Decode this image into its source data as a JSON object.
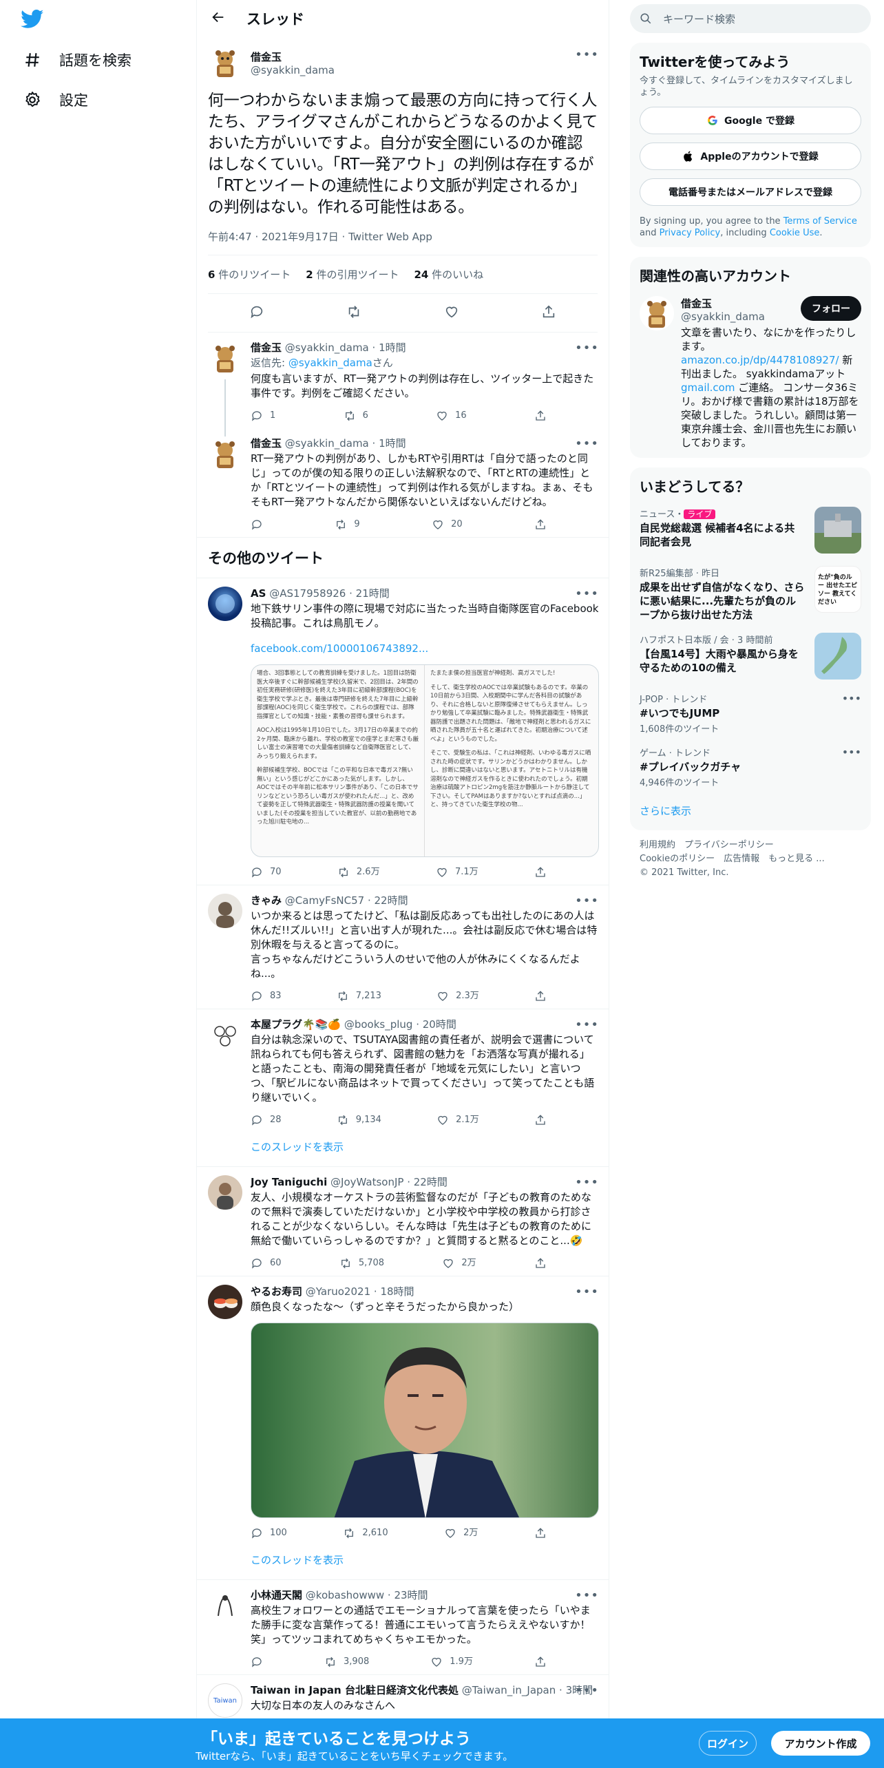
{
  "nav": {
    "explore": "話題を検索",
    "settings": "設定"
  },
  "header": {
    "title": "スレッド"
  },
  "focal": {
    "name": "借金玉",
    "handle": "@syakkin_dama",
    "text": "何一つわからないまま煽って最悪の方向に持って行く人たち、アライグマさんがこれからどうなるのかよく見ておいた方がいいですよ。自分が安全圏にいるのか確認はしなくていい。「RT一発アウト」の判例は存在するが「RTとツイートの連続性により文脈が判定されるか」の判例はない。作れる可能性はある。",
    "time": "午前4:47 · 2021年9月17日 · Twitter Web App",
    "retweets_n": "6",
    "retweets_label": "件のリツイート",
    "quotes_n": "2",
    "quotes_label": "件の引用ツイート",
    "likes_n": "24",
    "likes_label": "件のいいね"
  },
  "replies": [
    {
      "name": "借金玉",
      "handle": "@syakkin_dama",
      "time": "1時間",
      "reply_to_prefix": "返信先:",
      "reply_to_handle": "@syakkin_dama",
      "reply_to_suffix": "さん",
      "text": "何度も言いますが、RT一発アウトの判例は存在し、ツイッター上で起きた事件です。判例をご確認ください。",
      "reply": "1",
      "rt": "6",
      "like": "16"
    },
    {
      "name": "借金玉",
      "handle": "@syakkin_dama",
      "time": "1時間",
      "text": "RT一発アウトの判例があり、しかもRTや引用RTは「自分で語ったのと同じ」ってのが僕の知る限りの正しい法解釈なので、「RTとRTの連続性」とか「RTとツイートの連続性」って判例は作れる気がしますね。まぁ、そもそもRT一発アウトなんだから関係ないといえばないんだけどね。",
      "reply": "",
      "rt": "9",
      "like": "20"
    }
  ],
  "other_tweets_title": "その他のツイート",
  "tweets": [
    {
      "name": "AS",
      "handle": "@AS17958926",
      "time": "21時間",
      "text": "地下鉄サリン事件の際に現場で対応に当たった当時自衛隊医官のFacebook投稿記事。これは鳥肌モノ。",
      "link": "facebook.com/10000106743892...",
      "img_left": [
        "場合、3回事態としての教育訓練を受けました。1回目は防衛医大卒後すぐに幹部候補生学校(久留米で、2回目は、2年間の初任実務研修(研修医)を終えた3年目に初級幹部課程(BOC)を衛生学校で学ぶとき。最後は専門研修を終えた7年目に上級幹部課程(AOC)を同じく衛生学校で。これらの課程では、部隊指揮官としての知識・技能・素養の習得も課せられます。",
        "AOC入校は1995年1月10日でした。3月17日の卒業までの約2ヶ月間、臨床から離れ、学校の教室での座学とまだ寒さも厳しい富士の演習場での大量傷者訓練など自衛隊医官として、みっちり鍛えられます。",
        "幹部候補生学校、BOCでは「この平和な日本で毒ガス?無い無い」という感じがどこかにあった気がします。しかし、AOCではその半年前に松本サリン事件があり、「この日本でサリンなどという恐ろしい毒ガスが使われたんだ...」と、改めて姿勢を正して特殊武器衛生・特殊武器防護の授業を聞いていました(その授業を担当していた教官が、以前の勤務地であった旭川駐屯地の..."
      ],
      "img_right": [
        "たまたま僕の担当医官が神経剤、高ガスでした!",
        "そして、衛生学校のAOCでは卒業試験もあるのです。卒業の10日前から3日間、入校期間中に学んだ各科目の試験があり、それに合格しないと原隊復帰させてもらえません。しっかり勉強して卒業試験に臨みました。特殊武器衛生・特殊武器防護で出題された問題は、「敵地で神経剤と思われるガスに晒された隊員が五十名と運ばれてきた。初期治療について述べよ」というものでした。",
        "そこで、受験生の私は、「これは神経剤、いわゆる毒ガスに晒された時の症状です。サリンかどうかはわかりません。しかし、診断に間違いはないと思います。アセトニトリルは有機溶剤なので神経ガスを作るときに使われたのでしょう。初期治療は硫酸アトロピン2mgを筋注か静脈ルートから静注して下さい。そしてPAMはありますか?ないとすれば点滴の...」と、持ってきていた衛生学校の物..."
      ],
      "reply": "70",
      "rt": "2.6万",
      "like": "7.1万"
    },
    {
      "name": "きゃみ",
      "handle": "@CamyFsNC57",
      "time": "22時間",
      "text": "いつか来るとは思ってたけど、「私は副反応あっても出社したのにあの人は休んだ!!ズルい!!」と言い出す人が現れた...。会社は副反応で休む場合は特別休暇を与えると言ってるのに。\n言っちゃなんだけどこういう人のせいで他の人が休みにくくなるんだよね...。",
      "reply": "83",
      "rt": "7,213",
      "like": "2.3万"
    },
    {
      "name": "本屋プラグ🌴📚🍊",
      "handle": "@books_plug",
      "time": "20時間",
      "text": "自分は執念深いので、TSUTAYA図書館の責任者が、説明会で選書について訊ねられても何も答えられず、図書館の魅力を「お洒落な写真が撮れる」と語ったことも、南海の開発責任者が「地域を元気にしたい」と言いつつ、「駅ビルにない商品はネットで買ってください」って笑ってたことも語り継いでいく。",
      "reply": "28",
      "rt": "9,134",
      "like": "2.1万",
      "show_thread": "このスレッドを表示"
    },
    {
      "name": "Joy Taniguchi",
      "handle": "@JoyWatsonJP",
      "time": "22時間",
      "text": "友人、小規模なオーケストラの芸術監督なのだが「子どもの教育のためなので無料で演奏していただけないか」と小学校や中学校の教員から打診されることが少なくないらしい。そんな時は「先生は子どもの教育のために無給で働いていらっしゃるのですか？」と質問すると黙るとのこと...🤣",
      "reply": "60",
      "rt": "5,708",
      "like": "2万"
    },
    {
      "name": "やるお寿司",
      "handle": "@Yaruo2021",
      "time": "18時間",
      "text": "顔色良くなったな〜（ずっと辛そうだったから良かった）",
      "reply": "100",
      "rt": "2,610",
      "like": "2万",
      "show_thread": "このスレッドを表示"
    },
    {
      "name": "小林通天閣",
      "handle": "@kobashowww",
      "time": "23時間",
      "text": "高校生フォロワーとの通話でエモーショナルって言葉を使ったら「いやまた勝手に変な言葉作ってる！普通にエモいって言うたらええやないすか！笑」ってツッコまれてめちゃくちゃエモかった。",
      "reply": "",
      "rt": "3,908",
      "like": "1.9万"
    },
    {
      "name": "Taiwan in Japan 台北駐日経済文化代表処",
      "handle": "@Taiwan_in_Japan",
      "time": "3時間",
      "text": "大切な日本の友人のみなさんへ",
      "avatar_text": "Taiwan"
    }
  ],
  "right": {
    "search_placeholder": "キーワード検索",
    "signup": {
      "title": "Twitterを使ってみよう",
      "sub": "今すぐ登録して、タイムラインをカスタマイズしましょう。",
      "google": "Google で登録",
      "apple": "Appleのアカウントで登録",
      "phone": "電話番号またはメールアドレスで登録",
      "terms_1": "By signing up, you agree to the ",
      "terms_tos": "Terms of Service",
      "terms_2": " and ",
      "terms_privacy": "Privacy Policy",
      "terms_3": ", including ",
      "terms_cookie": "Cookie Use",
      "terms_4": "."
    },
    "relevant": {
      "title": "関連性の高いアカウント",
      "name": "借金玉",
      "handle": "@syakkin_dama",
      "follow": "フォロー",
      "bio_1": "文章を書いたり、なにかを作ったりします。",
      "bio_link": "amazon.co.jp/dp/4478108927/",
      "bio_2": "新刊出ました。 syakkindamaアット",
      "bio_gmail": "gmail.com",
      "bio_3": " ご連絡。 コンサータ36ミリ。おかげ様で書籍の累計は18万部を突破しました。うれしい。顧問は第一東京弁護士会、金川晋也先生にお願いしております。"
    },
    "trends": {
      "title": "いまどうしてる？",
      "items": [
        {
          "cat": "ニュース・",
          "badge": "ライブ",
          "title": "自民党総裁選 候補者4名による共同記者会見"
        },
        {
          "cat": "新R25編集部 · 昨日",
          "title": "成果を出せず自信がなくなり、さらに悪い結果に...先輩たちが負のループから抜け出せた方法"
        },
        {
          "cat": "ハフポスト日本版 / 会 · 3 時間前",
          "title": "【台風14号】大雨や暴風から身を守るための10の備え"
        },
        {
          "cat": "J-POP · トレンド",
          "title": "#いつでもJUMP",
          "count": "1,608件のツイート"
        },
        {
          "cat": "ゲーム · トレンド",
          "title": "#プレイバックガチャ",
          "count": "4,946件のツイート"
        }
      ],
      "thumb2_text": "たが\"負のルー 出せたエピソー 教えてください",
      "show_more": "さらに表示"
    },
    "footer": {
      "terms": "利用規約",
      "privacy": "プライバシーポリシー",
      "cookie": "Cookieのポリシー",
      "ads": "広告情報",
      "more": "もっと見る ...",
      "copyright": "© 2021 Twitter, Inc."
    }
  },
  "bottombar": {
    "headline": "「いま」起きていることを見つけよう",
    "sub": "Twitterなら、「いま」起きていることをいち早くチェックできます。",
    "login": "ログイン",
    "signup": "アカウント作成"
  },
  "colors": {
    "accent": "#1d9bf0",
    "text": "#0f1419",
    "muted": "#536471",
    "live": "#f91880"
  }
}
